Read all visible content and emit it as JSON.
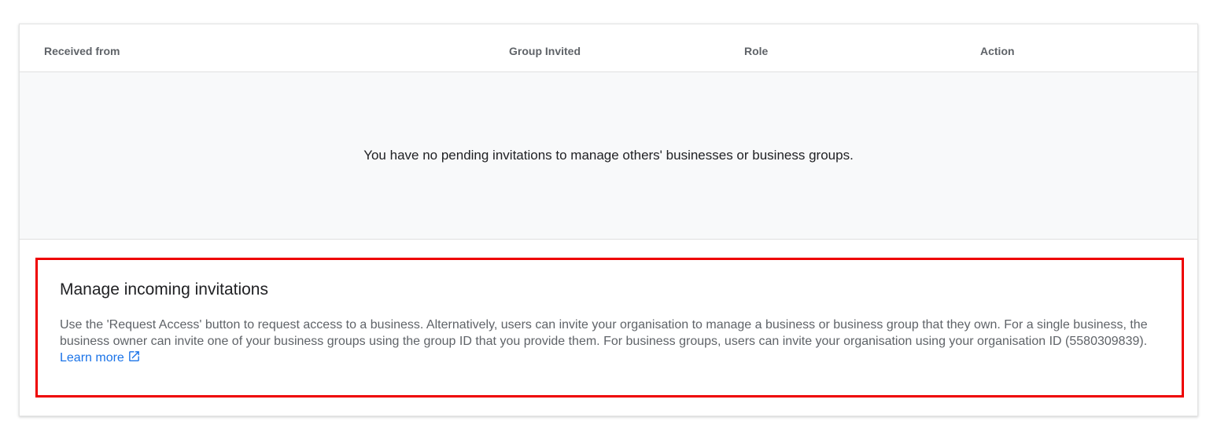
{
  "table": {
    "columns": [
      "Received from",
      "Group Invited",
      "Role",
      "Action"
    ],
    "empty_message": "You have no pending invitations to manage others' businesses or business groups."
  },
  "invitations": {
    "title": "Manage incoming invitations",
    "description": "Use the 'Request Access' button to request access to a business. Alternatively, users can invite your organisation to manage a business or business group that they own. For a single business, the business owner can invite one of your business groups using the group ID that you provide them. For business groups, users can invite your organisation using your organisation ID (5580309839).",
    "learn_more_label": "Learn more",
    "learn_more_icon": "open-in-new-icon"
  },
  "colors": {
    "highlight_border": "#ee0000",
    "link": "#1a73e8",
    "header_text": "#5f6368",
    "empty_background": "#f8f9fa"
  }
}
